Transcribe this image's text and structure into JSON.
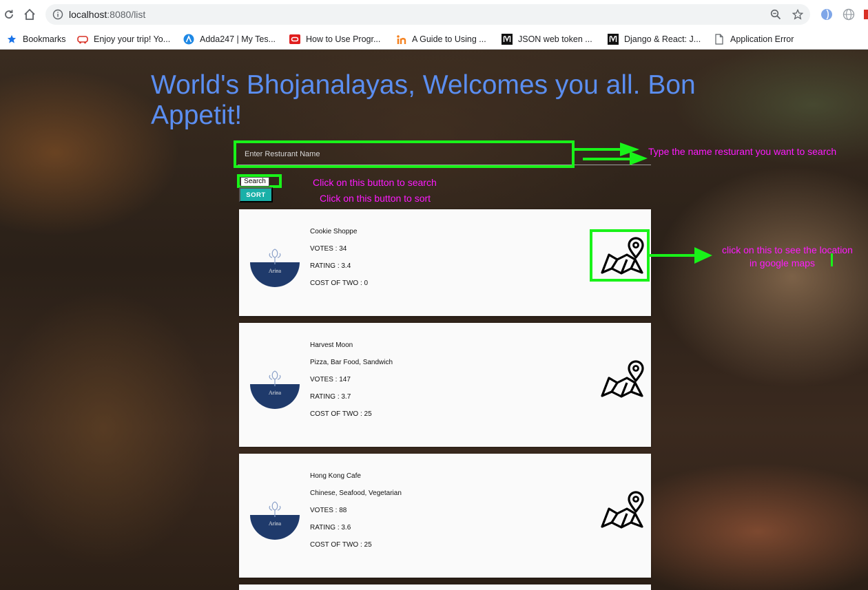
{
  "browser": {
    "url_host": "localhost",
    "url_path": ":8080/list",
    "bookmarks": [
      {
        "label": "Bookmarks",
        "icon": "star-icon"
      },
      {
        "label": "Enjoy your trip! Yo...",
        "icon": "bus-icon"
      },
      {
        "label": "Adda247 | My Tes...",
        "icon": "adda-icon"
      },
      {
        "label": "How to Use Progr...",
        "icon": "oracle-icon"
      },
      {
        "label": "A Guide to Using ...",
        "icon": "indeed-icon"
      },
      {
        "label": "JSON web token ...",
        "icon": "medium-icon"
      },
      {
        "label": "Django & React: J...",
        "icon": "medium-icon"
      },
      {
        "label": "Application Error",
        "icon": "page-icon"
      }
    ]
  },
  "page": {
    "heading": "World's Bhojanalayas, Welcomes you all. Bon Appetit!",
    "search_placeholder": "Enter Resturant Name",
    "search_button": "Search",
    "sort_button": "SORT"
  },
  "annotations": {
    "search_field_note": "Type the name resturant you want to search",
    "search_button_note": "Click on this button to search",
    "sort_button_note": "Click on this button to sort",
    "map_note_line1": "click on this to see the location",
    "map_note_line2": "in google  maps"
  },
  "restaurants": [
    {
      "name": "Cookie Shoppe",
      "cuisines": "",
      "votes": "VOTES : 34",
      "rating": "RATING : 3.4",
      "cost": "COST OF TWO : 0"
    },
    {
      "name": "Harvest Moon",
      "cuisines": "Pizza, Bar Food, Sandwich",
      "votes": "VOTES : 147",
      "rating": "RATING : 3.7",
      "cost": "COST OF TWO : 25"
    },
    {
      "name": "Hong Kong Cafe",
      "cuisines": "Chinese, Seafood, Vegetarian",
      "votes": "VOTES : 88",
      "rating": "RATING : 3.6",
      "cost": "COST OF TWO : 25"
    }
  ],
  "logo_text": "Arina",
  "colors": {
    "heading": "#5b8ef0",
    "annotation": "#ff1aff",
    "highlight": "#19f219",
    "sort_button": "#1ab0a8",
    "logo_navy": "#1f3a6b"
  }
}
